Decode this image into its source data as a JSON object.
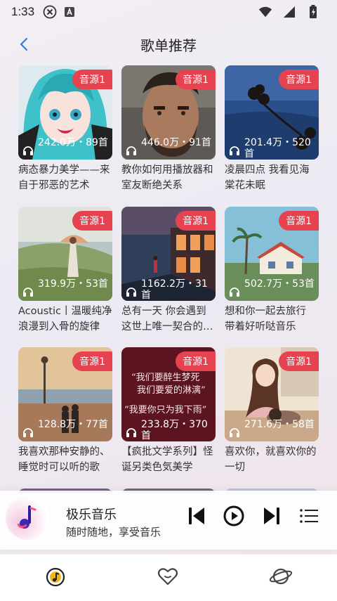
{
  "status_bar": {
    "time": "1:33"
  },
  "header": {
    "title": "歌单推荐"
  },
  "playlists": [
    {
      "badge": "音源1",
      "plays": "242.0万・89首",
      "name": "病态暴力美学——来自于邪恶的艺术"
    },
    {
      "badge": "音源1",
      "plays": "446.0万・91首",
      "name": "教你如何用播放器和室友断绝关系"
    },
    {
      "badge": "音源1",
      "plays": "201.4万・520首",
      "name": "凌晨四点 我看见海棠花未眠"
    },
    {
      "badge": "音源1",
      "plays": "319.9万・53首",
      "name": "Acoustic丨温暖纯净 浪漫到入骨的旋律"
    },
    {
      "badge": "音源1",
      "plays": "1162.2万・31首",
      "name": "总有一天 你会遇到这世上唯一契合的灵魂"
    },
    {
      "badge": "音源1",
      "plays": "502.7万・53首",
      "name": "想和你一起去旅行 带着好听哒音乐"
    },
    {
      "badge": "音源1",
      "plays": "128.8万・77首",
      "name": "我喜欢那种安静的、睡觉时可以听的歌"
    },
    {
      "badge": "音源1",
      "plays": "233.8万・370首",
      "name": "【疯批文学系列】怪诞另类色気美学",
      "cover_line1": "“我们要醉生梦死",
      "cover_line2": "我们要爱的淋漓”",
      "cover_line3": "“我要你只为我下雨”"
    },
    {
      "badge": "音源1",
      "plays": "271.6万・58首",
      "name": "喜欢你，就喜欢你的一切"
    }
  ],
  "player": {
    "title": "极乐音乐",
    "subtitle": "随时随地，享受音乐"
  },
  "colors": {
    "badge": "#e6424f",
    "accent": "#2b7de0",
    "tab_active": "#f1b51c"
  }
}
